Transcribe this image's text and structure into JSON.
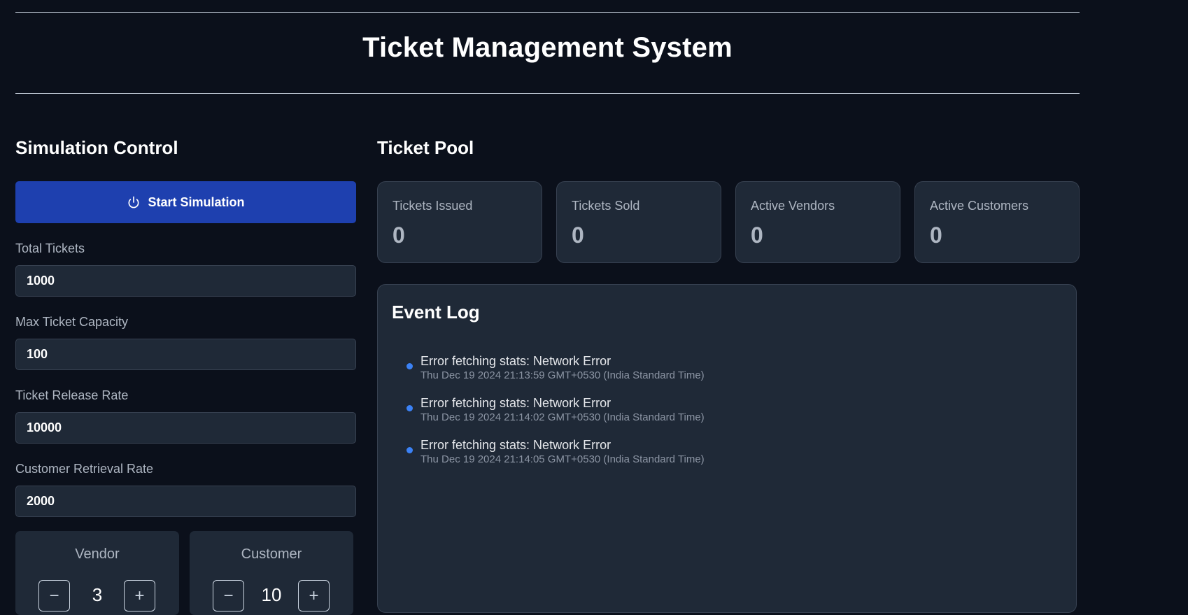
{
  "header": {
    "title": "Ticket Management System"
  },
  "simulation": {
    "title": "Simulation Control",
    "start_label": "Start Simulation",
    "fields": [
      {
        "label": "Total Tickets",
        "value": "1000"
      },
      {
        "label": "Max Ticket Capacity",
        "value": "100"
      },
      {
        "label": "Ticket Release Rate",
        "value": "10000"
      },
      {
        "label": "Customer Retrieval Rate",
        "value": "2000"
      }
    ],
    "counters": [
      {
        "label": "Vendor",
        "value": "3",
        "minus": "−",
        "plus": "+"
      },
      {
        "label": "Customer",
        "value": "10",
        "minus": "−",
        "plus": "+"
      }
    ]
  },
  "pool": {
    "title": "Ticket Pool",
    "stats": [
      {
        "label": "Tickets Issued",
        "value": "0"
      },
      {
        "label": "Tickets Sold",
        "value": "0"
      },
      {
        "label": "Active Vendors",
        "value": "0"
      },
      {
        "label": "Active Customers",
        "value": "0"
      }
    ]
  },
  "event_log": {
    "title": "Event Log",
    "entries": [
      {
        "message": "Error fetching stats: Network Error",
        "time": "Thu Dec 19 2024 21:13:59 GMT+0530 (India Standard Time)"
      },
      {
        "message": "Error fetching stats: Network Error",
        "time": "Thu Dec 19 2024 21:14:02 GMT+0530 (India Standard Time)"
      },
      {
        "message": "Error fetching stats: Network Error",
        "time": "Thu Dec 19 2024 21:14:05 GMT+0530 (India Standard Time)"
      }
    ]
  },
  "icons": {
    "start": "power-icon"
  },
  "colors": {
    "accent": "#1e40af",
    "log_dot": "#3b82f6",
    "background": "#0b101b",
    "card": "#1f2937"
  }
}
